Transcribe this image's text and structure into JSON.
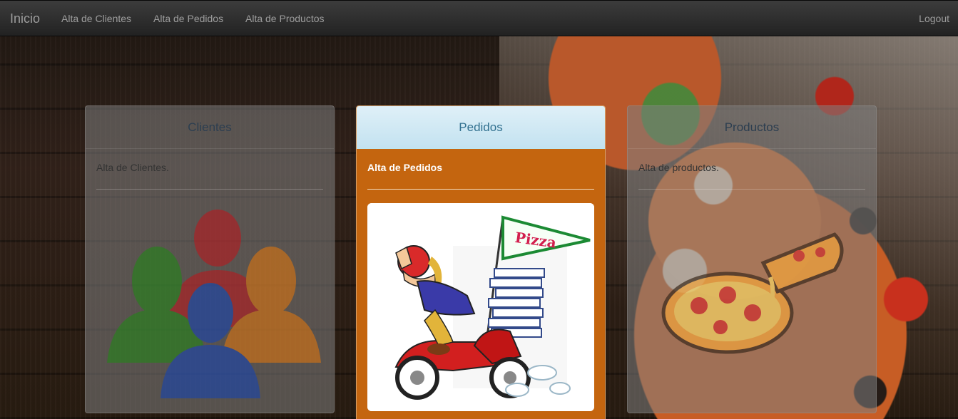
{
  "navbar": {
    "brand": "Inicio",
    "links": [
      "Alta de Clientes",
      "Alta de Pedidos",
      "Alta de Productos"
    ],
    "logout": "Logout"
  },
  "panels": {
    "clientes": {
      "title": "Clientes",
      "text": "Alta de Clientes."
    },
    "pedidos": {
      "title": "Pedidos",
      "text": "Alta de Pedidos",
      "flag_text": "Pizza"
    },
    "productos": {
      "title": "Productos",
      "text": "Alta de productos."
    }
  },
  "colors": {
    "navbar": "#222222",
    "pedidos_panel": "#c4650f",
    "pedidos_heading": "#d9edf7"
  }
}
